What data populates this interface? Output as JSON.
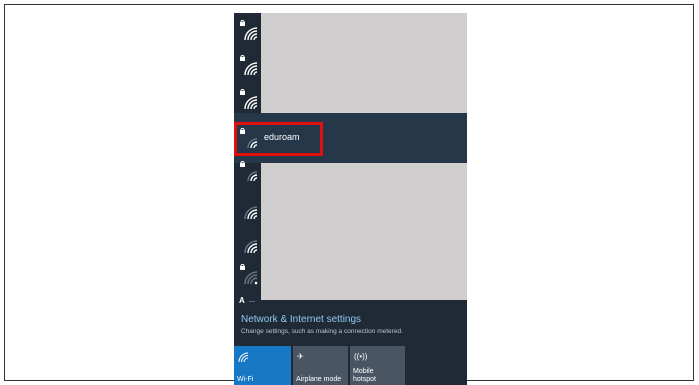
{
  "selected_network": {
    "name": "eduroam"
  },
  "settings": {
    "title": "Network & Internet settings",
    "subtitle": "Change settings, such as making a connection metered."
  },
  "partial_item": "A",
  "quick_actions": [
    {
      "label": "Wi-Fi",
      "icon": "wifi-icon",
      "color": "#1778c6"
    },
    {
      "label": "Airplane mode",
      "icon": "airplane-icon",
      "color": "#4a5563"
    },
    {
      "label": "Mobile hotspot",
      "icon": "hotspot-icon",
      "color": "#4a5563"
    }
  ],
  "colors": {
    "panel": "#1f2a36",
    "selected_row": "#26374a",
    "highlight": "#e01010",
    "link": "#8ec9f2"
  }
}
